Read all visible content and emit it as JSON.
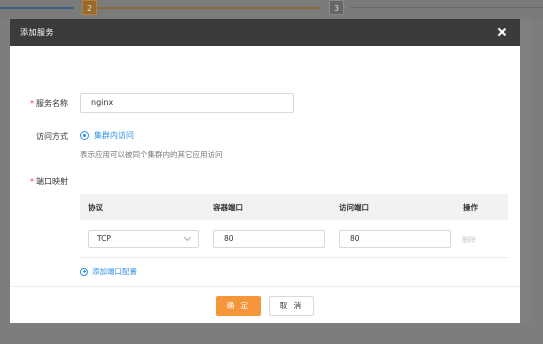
{
  "steps": {
    "step2": "2",
    "step3": "3"
  },
  "modal": {
    "title": "添加服务",
    "close_icon": "close-icon"
  },
  "form": {
    "service_name_label": "服务名称",
    "service_name_value": "nginx",
    "access_mode_label": "访问方式",
    "access_mode_option": "集群内访问",
    "access_mode_desc": "表示应用可以被同个集群内的其它应用访问",
    "port_mapping_label": "端口映射",
    "required_mark": "*"
  },
  "port_table": {
    "headers": [
      "协议",
      "容器端口",
      "访问端口",
      "操作"
    ],
    "rows": [
      {
        "protocol": "TCP",
        "container_port": "80",
        "access_port": "80",
        "action": "删除"
      }
    ],
    "add_link": "添加端口配置"
  },
  "footer": {
    "ok_label": "确 定",
    "cancel_label": "取 消"
  },
  "colors": {
    "accent": "#2e8fe6",
    "primary_button": "#f6963a",
    "required": "#e8483f",
    "header": "#3b3b3b"
  }
}
